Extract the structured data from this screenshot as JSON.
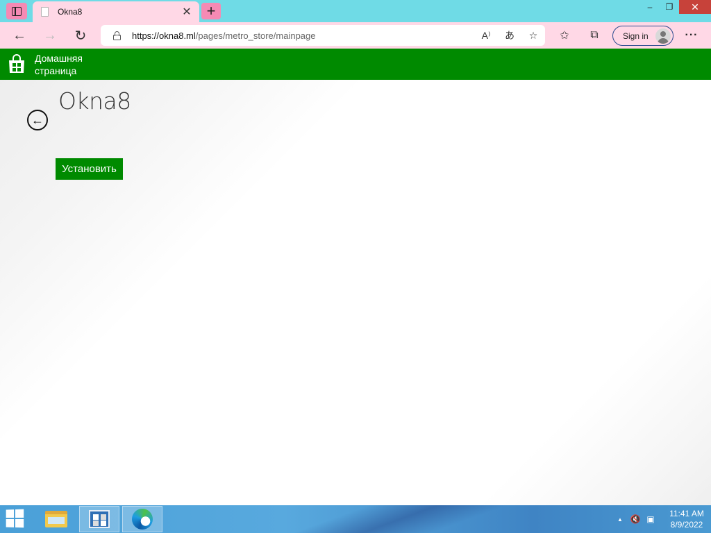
{
  "browser": {
    "tab_title": "Okna8",
    "tab_close": "✕",
    "new_tab": "+",
    "url_host": "https://okna8.ml",
    "url_path": "/pages/metro_store/mainpage",
    "sign_in_label": "Sign in",
    "more_label": "···",
    "window_controls": {
      "minimize": "–",
      "restore": "❐",
      "close": "✕"
    }
  },
  "store": {
    "header_label": "Домашняя страница",
    "app_title": "Okna8",
    "install_label": "Установить",
    "accent_color": "#008a00"
  },
  "taskbar": {
    "time": "11:41 AM",
    "date": "8/9/2022"
  },
  "icons": {
    "back": "←",
    "forward": "→",
    "refresh": "↻",
    "read_aloud": "A⁾",
    "translate": "あ",
    "add_favorite": "☆",
    "favorites": "✩",
    "collections": "⧉",
    "page_back": "←",
    "tray_up": "▲",
    "volume": "🔇",
    "network": "▣"
  }
}
